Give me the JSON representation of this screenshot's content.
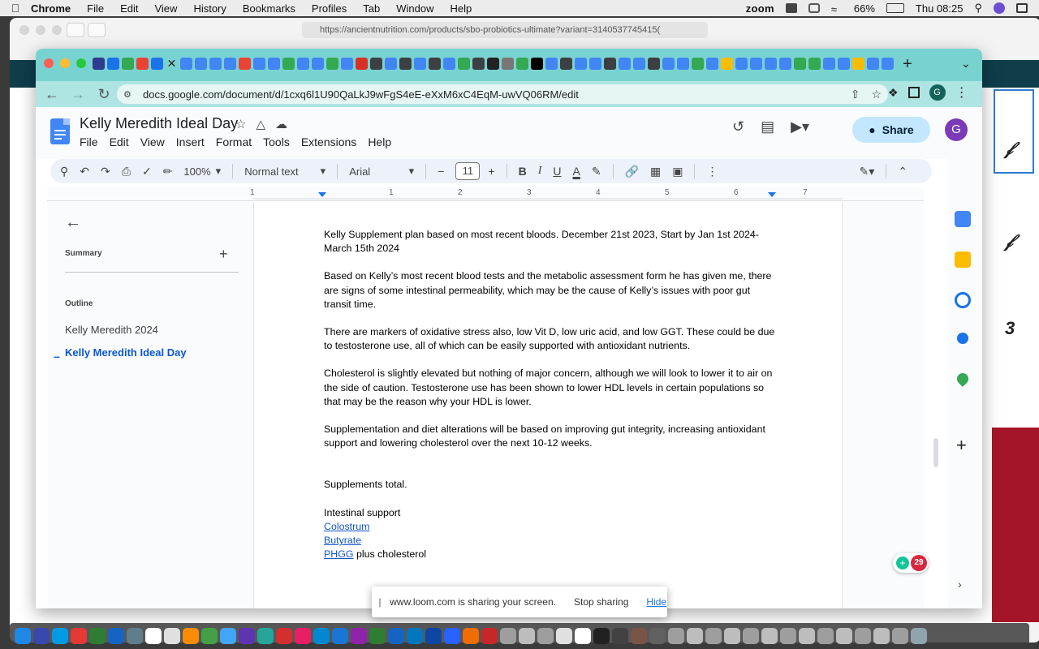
{
  "menubar": {
    "app": "Chrome",
    "items": [
      "File",
      "Edit",
      "View",
      "History",
      "Bookmarks",
      "Profiles",
      "Tab",
      "Window",
      "Help"
    ],
    "zoom": "zoom",
    "battery": "66%",
    "clock": "Thu 08:25"
  },
  "background_window": {
    "url": "https://ancientnutrition.com/products/sbo-probiotics-ultimate?variant=3140537745415("
  },
  "browser": {
    "url": "docs.google.com/document/d/1cxq6l1U90QaLkJ9wFgS4eE-eXxM6xC4EqM-uwVQ06RM/edit",
    "profile_initial": "G"
  },
  "docs": {
    "title": "Kelly Meredith Ideal Day",
    "menu": [
      "File",
      "Edit",
      "View",
      "Insert",
      "Format",
      "Tools",
      "Extensions",
      "Help"
    ],
    "share_label": "Share",
    "avatar_initial": "G",
    "toolbar": {
      "zoom": "100%",
      "style": "Normal text",
      "font": "Arial",
      "font_size": "11"
    },
    "ruler_numbers": [
      "1",
      "1",
      "2",
      "3",
      "4",
      "5",
      "6",
      "7"
    ]
  },
  "outline_panel": {
    "summary_label": "Summary",
    "outline_label": "Outline",
    "items": [
      {
        "label": "Kelly Meredith 2024",
        "active": false
      },
      {
        "label": "Kelly Meredith Ideal Day",
        "active": true
      }
    ]
  },
  "document": {
    "paragraphs": [
      "Kelly Supplement plan based on most recent bloods. December 21st 2023, Start by Jan 1st 2024-March 15th 2024",
      "Based on Kelly’s most recent blood tests and the metabolic assessment form he has given me, there are signs of some intestinal permeability, which may be the cause of Kelly’s issues with poor gut transit time.",
      "There are markers of oxidative stress also, low Vit D, low uric acid, and low GGT. These could be due to testosterone use, all of which can be easily supported with antioxidant nutrients.",
      "Cholesterol is slightly elevated but nothing of major concern, although we will look to lower it to air on the side of caution. Testosterone use has been shown to lower HDL levels in certain populations so that may be the reason why your HDL is lower.",
      "Supplementation and diet alterations will be based on improving gut integrity, increasing antioxidant support and lowering cholesterol over the next 10-12 weeks."
    ],
    "supplements_heading": "Supplements total.",
    "section_heading": "Intestinal support",
    "links": [
      "Colostrum",
      "Butyrate",
      "PHGG"
    ],
    "phgg_suffix": " plus cholesterol"
  },
  "grammarly_count": "29",
  "loom": {
    "message": "www.loom.com is sharing your screen.",
    "stop_label": "Stop sharing",
    "hide_label": "Hide"
  }
}
